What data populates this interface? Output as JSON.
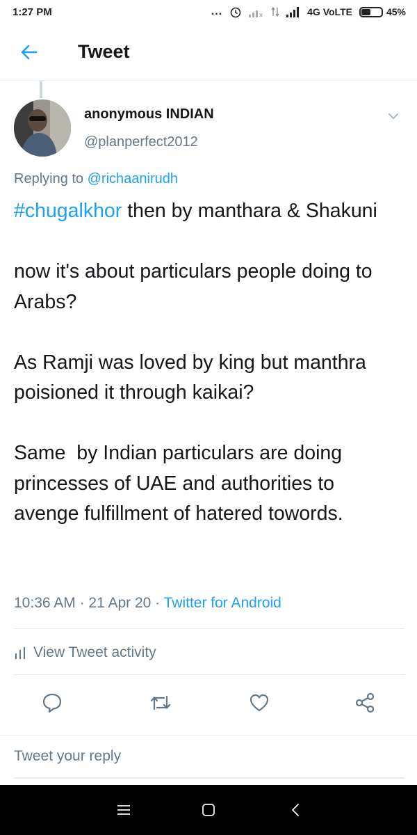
{
  "status_bar": {
    "time": "1:27 PM",
    "dots": "...",
    "network": "4G VoLTE",
    "battery_percent": "45%",
    "battery_level": 0.45
  },
  "header": {
    "back_icon": "arrow-left-icon",
    "title": "Tweet"
  },
  "tweet": {
    "author": {
      "name": "anonymous INDIAN",
      "handle": "@planperfect2012"
    },
    "replying_prefix": "Replying to",
    "replying_to": "@richaanirudh",
    "hashtag": "#chugalkhor",
    "body": " then by manthara & Shakuni\n\nnow it's about particulars people doing to Arabs?\n\nAs Ramji was loved by king but manthra poisioned it through kaikai?\n\nSame  by Indian particulars are doing princesses of UAE and authorities to avenge fulfillment of hatered towords.",
    "time": "10:36 AM",
    "separator": " · ",
    "date": "21 Apr 20",
    "source": "Twitter for Android"
  },
  "activity": {
    "label": "View Tweet activity",
    "icon": "bar-chart-icon"
  },
  "actions": [
    {
      "name": "reply",
      "icon": "comment-icon"
    },
    {
      "name": "retweet",
      "icon": "retweet-icon"
    },
    {
      "name": "like",
      "icon": "heart-icon"
    },
    {
      "name": "share",
      "icon": "share-icon"
    }
  ],
  "reply_input": {
    "placeholder": "Tweet your reply"
  },
  "colors": {
    "accent": "#1da1f2",
    "text": "#14171a",
    "secondary": "#657786",
    "divider": "#e6ecf0"
  }
}
